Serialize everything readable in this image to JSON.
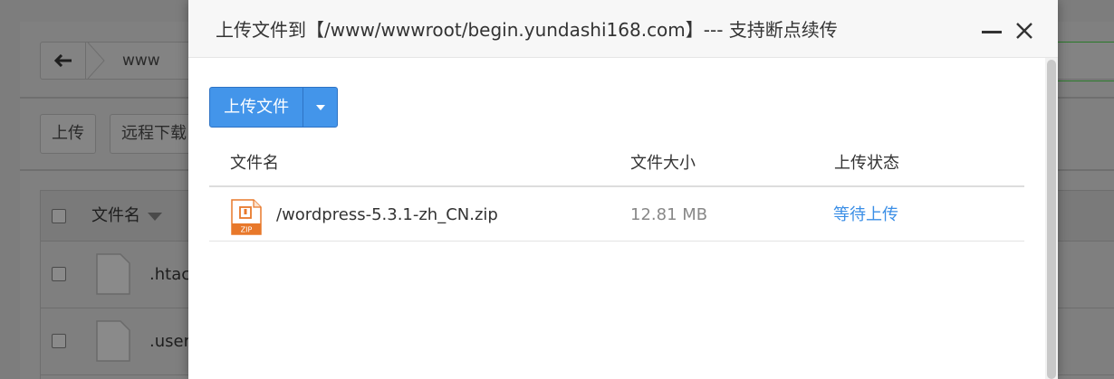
{
  "background": {
    "breadcrumb": [
      "www"
    ],
    "toolbar": {
      "upload_label": "上传",
      "remote_download_label": "远程下载"
    },
    "table": {
      "header_name": "文件名",
      "rows": [
        {
          "name": ".htacc"
        },
        {
          "name": ".user."
        }
      ]
    }
  },
  "dialog": {
    "title": "上传文件到【/www/wwwroot/begin.yundashi168.com】--- 支持断点续传",
    "upload_button_label": "上传文件",
    "columns": {
      "name": "文件名",
      "size": "文件大小",
      "status": "上传状态"
    },
    "files": [
      {
        "name": "/wordpress-5.3.1-zh_CN.zip",
        "size": "12.81 MB",
        "status": "等待上传",
        "icon": "zip-file-icon"
      }
    ],
    "colors": {
      "primary": "#4395ea",
      "status": "#3a8ee6",
      "zip_icon": "#e8782a"
    }
  }
}
